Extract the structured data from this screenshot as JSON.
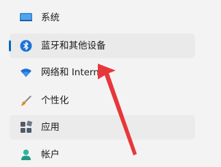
{
  "nav": {
    "items": [
      {
        "label": "系统",
        "icon": "display-icon"
      },
      {
        "label": "蓝牙和其他设备",
        "icon": "bluetooth-icon"
      },
      {
        "label": "网络和 Interne",
        "icon": "wifi-icon"
      },
      {
        "label": "个性化",
        "icon": "brush-icon"
      },
      {
        "label": "应用",
        "icon": "apps-icon"
      },
      {
        "label": "帐户",
        "icon": "account-icon"
      }
    ]
  },
  "colors": {
    "accent": "#0067c0",
    "annotation_arrow": "#e8373a"
  }
}
